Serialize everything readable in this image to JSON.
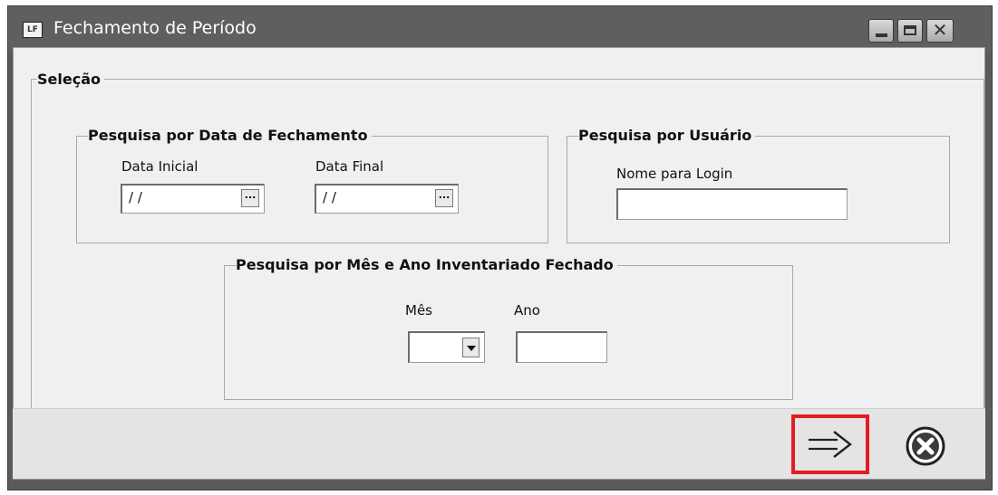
{
  "window": {
    "title": "Fechamento de Período",
    "app_icon_text": "LF"
  },
  "selection_group": {
    "legend": "Seleção"
  },
  "date_group": {
    "legend": "Pesquisa por Data de Fechamento",
    "start_label": "Data Inicial",
    "start_value": "/ /",
    "end_label": "Data Final",
    "end_value": "/ /",
    "ellipsis": "..."
  },
  "user_group": {
    "legend": "Pesquisa por Usuário",
    "login_label": "Nome para Login",
    "login_value": ""
  },
  "month_year_group": {
    "legend": "Pesquisa por Mês e Ano Inventariado Fechado",
    "month_label": "Mês",
    "month_value": "",
    "year_label": "Ano",
    "year_value": ""
  },
  "icons": {
    "next": "arrow-right-icon",
    "cancel": "cancel-circle-x-icon"
  },
  "colors": {
    "highlight": "#e31b23",
    "titlebar": "#5f5f5f"
  }
}
